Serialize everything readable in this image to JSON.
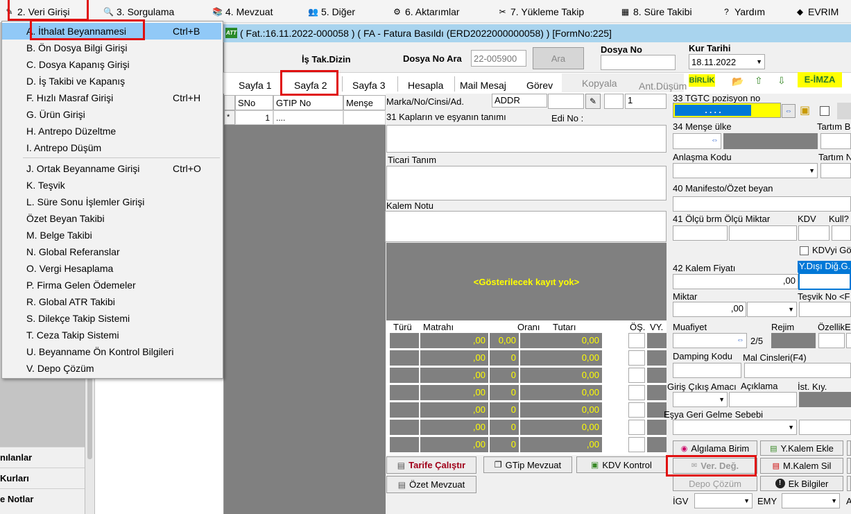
{
  "menubar": {
    "items": [
      {
        "label": "2.  Veri Girişi"
      },
      {
        "label": "3.  Sorgulama"
      },
      {
        "label": "4.  Mevzuat"
      },
      {
        "label": "5.  Diğer"
      },
      {
        "label": "6.  Aktarımlar"
      },
      {
        "label": "7.  Yükleme Takip"
      },
      {
        "label": "8. Süre Takibi"
      },
      {
        "label": "Yardım"
      },
      {
        "label": "EVRIM"
      }
    ]
  },
  "dropdown": {
    "items": [
      {
        "label": "A.  İthalat Beyannamesi",
        "shortcut": "Ctrl+B"
      },
      {
        "label": "B.  Ön Dosya Bilgi Girişi",
        "shortcut": ""
      },
      {
        "label": "C.  Dosya Kapanış Girişi",
        "shortcut": ""
      },
      {
        "label": "D.  İş Takibi ve Kapanış",
        "shortcut": ""
      },
      {
        "label": "F.  Hızlı Masraf Girişi",
        "shortcut": "Ctrl+H"
      },
      {
        "label": "G.  Ürün Girişi",
        "shortcut": ""
      },
      {
        "label": "H.  Antrepo Düzeltme",
        "shortcut": ""
      },
      {
        "label": "I.   Antrepo Düşüm",
        "shortcut": ""
      },
      {
        "label": "J.  Ortak Beyanname Girişi",
        "shortcut": "Ctrl+O"
      },
      {
        "label": "K.  Teşvik",
        "shortcut": ""
      },
      {
        "label": "L.  Süre Sonu İşlemler Girişi",
        "shortcut": ""
      },
      {
        "label": "     Özet Beyan Takibi",
        "shortcut": ""
      },
      {
        "label": "M.   Belge Takibi",
        "shortcut": ""
      },
      {
        "label": "N.  Global Referanslar",
        "shortcut": ""
      },
      {
        "label": "O. Vergi Hesaplama",
        "shortcut": ""
      },
      {
        "label": "P. Firma Gelen Ödemeler",
        "shortcut": ""
      },
      {
        "label": "R. Global ATR Takibi",
        "shortcut": ""
      },
      {
        "label": "S. Dilekçe Takip Sistemi",
        "shortcut": ""
      },
      {
        "label": "T. Ceza Takip Sistemi",
        "shortcut": ""
      },
      {
        "label": "U. Beyanname Ön Kontrol Bilgileri",
        "shortcut": ""
      },
      {
        "label": "V. Depo Çözüm",
        "shortcut": ""
      }
    ]
  },
  "sidebar": {
    "items": [
      "nılanlar",
      "Kurları",
      "e Notlar"
    ]
  },
  "window": {
    "title": "( Fat.:16.11.2022-000058 ) ( FA  - Fatura Basıldı (ERD2022000000058) ) [FormNo:225]"
  },
  "header": {
    "is_tak_dizin": "İş Tak.Dizin",
    "dosya_no_ara_label": "Dosya No Ara",
    "dosya_no_ara_value": "22-005900",
    "ara_button": "Ara",
    "dosya_no_label": "Dosya No",
    "dosya_no_value": "",
    "kur_tarihi_label": "Kur Tarihi",
    "kur_tarihi_value": "18.11.2022"
  },
  "tabs": {
    "items": [
      "Sayfa 1",
      "Sayfa 2",
      "Sayfa 3",
      "Hesapla",
      "Mail Mesaj",
      "Görev",
      "Kopyala",
      "Ant.Düşüm"
    ],
    "birlik": "BİRLİK",
    "eimza": "E-İMZA"
  },
  "grid": {
    "headers": [
      "SNo",
      "GTIP No",
      "Menşe"
    ],
    "row_marker": "*",
    "row_sno": "1",
    "row_gtip": "...."
  },
  "form": {
    "marka_label": "Marka/No/Cinsi/Ad.",
    "marka_value": "ADDR",
    "marka_count": "1",
    "kaplar_label": "31 Kapların ve eşyanın tanımı",
    "edi_label": "Edi No :",
    "ticari_label": "Ticari Tanım",
    "kalem_notu_label": "Kalem Notu",
    "no_records": "<Gösterilecek kayıt yok>",
    "tax_headers": [
      "Türü",
      "Matrahı",
      "Oranı",
      "Tutarı",
      "ÖŞ.",
      "VY."
    ],
    "tax_rows": [
      {
        "matrah": ",00",
        "oran": "0,00",
        "tutar": "0,00"
      },
      {
        "matrah": ",00",
        "oran": "0",
        "tutar": "0,00"
      },
      {
        "matrah": ",00",
        "oran": "0",
        "tutar": "0,00"
      },
      {
        "matrah": ",00",
        "oran": "0",
        "tutar": "0,00"
      },
      {
        "matrah": ",00",
        "oran": "0",
        "tutar": "0,00"
      },
      {
        "matrah": ",00",
        "oran": "0",
        "tutar": "0,00"
      },
      {
        "matrah": ",00",
        "oran": "0",
        "tutar": ",00"
      }
    ],
    "tarife_button": "Tarife Çalıştır",
    "gtip_mevzuat_button": "GTip Mevzuat",
    "kdv_kontrol_button": "KDV Kontrol",
    "ozet_mevzuat_button": "Özet Mevzuat"
  },
  "right": {
    "gtc_label": "33 TGTC pozisyon no",
    "gtc_value": ".    .    .    .",
    "mense_label": "34 Menşe ülke",
    "tartim_b_label": "Tartım B",
    "anlasma_label": "Anlaşma Kodu",
    "tartim_n_label": "Tartım N",
    "manifesto_label": "40 Manifesto/Özet beyan",
    "olcu_label": "41 Ölçü brm Ölçü Miktar",
    "kdv_label": "KDV",
    "kull_label": "Kull?",
    "kdvyi_label": "KDVyi Gö",
    "kalem_fiyati_label": "42 Kalem Fiyatı",
    "kalem_fiyati_value": ",00",
    "ydisi_label": "Y.Dışı Diğ.G.",
    "miktar_label": "Miktar",
    "miktar_value": ",00",
    "tesvik_label": "Teşvik No <F",
    "muafiyet_label": "Muafiyet",
    "muafiyet_value": "2/5",
    "rejim_label": "Rejim",
    "ozellik_label": "ÖzellikE",
    "damping_label": "Damping Kodu",
    "mal_cins_label": "Mal Cinsleri(F4)",
    "giris_label": "Giriş Çıkış Amacı",
    "aciklama_label": "Açıklama",
    "ist_label": "İst. Kıy.",
    "esya_label": "Eşya Geri Gelme Sebebi",
    "algilama_button": "Algılama Birim",
    "ykalem_button": "Y.Kalem Ekle",
    "ver_deg_button": "Ver. Değ.",
    "mkalem_button": "M.Kalem Sil",
    "depo_cozum_button": "Depo Çözüm",
    "ek_bilgiler_button": "Ek Bilgiler",
    "igv_label": "İGV",
    "emy_label": "EMY",
    "a_label": "A"
  }
}
